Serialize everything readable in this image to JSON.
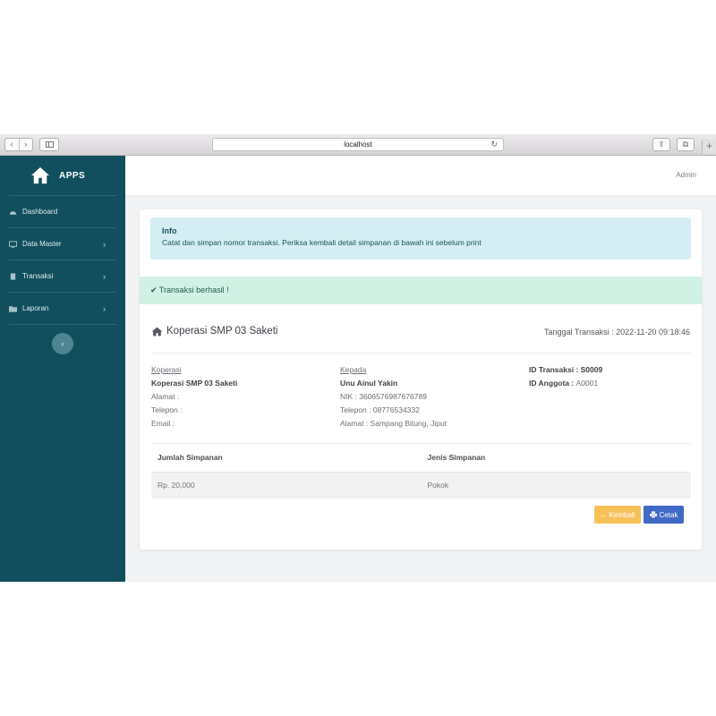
{
  "browser": {
    "url": "localhost",
    "back_glyph": "‹",
    "forward_glyph": "›",
    "reload_glyph": "↻",
    "share_glyph": "⇪",
    "tabs_glyph": "⧉",
    "new_tab_glyph": "+"
  },
  "sidebar": {
    "brand": "APPS",
    "brand_icon": "home-icon",
    "items": [
      {
        "label": "Dashboard",
        "icon": "dashboard-icon",
        "has_submenu": false
      },
      {
        "label": "Data Master",
        "icon": "monitor-icon",
        "has_submenu": true
      },
      {
        "label": "Transaksi",
        "icon": "file-icon",
        "has_submenu": true
      },
      {
        "label": "Laporan",
        "icon": "folder-icon",
        "has_submenu": true
      }
    ],
    "chevron": "›",
    "collapse_glyph": "‹",
    "bg_color": "#114f5e"
  },
  "topbar": {
    "user": "Admin"
  },
  "alert_info": {
    "title": "Info",
    "message": "Catat dan simpan nomor transaksi. Periksa kembali detail simpanan di bawah ini sebelum print"
  },
  "alert_success": {
    "icon": "check-icon",
    "glyph": "✔",
    "message": "Transaksi berhasil !"
  },
  "invoice": {
    "company": "Koperasi SMP 03 Saketi",
    "date_label": "Tanggal Transaksi : ",
    "date_value": "2022-11-20 09:18:46",
    "from": {
      "heading": "Koperasi",
      "name": "Koperasi SMP 03 Saketi",
      "alamat": "Alamat :",
      "telepon": "Telepon :",
      "email": "Email :"
    },
    "to": {
      "heading": "Kepada",
      "name": "Unu Ainul Yakin",
      "nik": "NIK : 3606576987676789",
      "telepon": "Telepon : 08776534332",
      "alamat": "Alamat : Sampang Bitung, Jiput"
    },
    "ids": {
      "transaksi_label": "ID Transaksi : ",
      "transaksi_value": "S0009",
      "anggota_label": "ID Anggota : ",
      "anggota_value": "A0001"
    },
    "table": {
      "headers": [
        "Jumlah Simpanan",
        "Jenis Simpanan"
      ],
      "rows": [
        [
          "Rp. 20,000",
          "Pokok"
        ]
      ]
    },
    "buttons": {
      "back": "Kembali",
      "back_glyph": "←",
      "print": "Cetak",
      "print_icon": "printer-icon"
    }
  },
  "colors": {
    "info_bg": "#d4eef3",
    "success_bg": "#d1f1e5",
    "back_button": "#f7c15a",
    "print_button": "#4169c6"
  }
}
